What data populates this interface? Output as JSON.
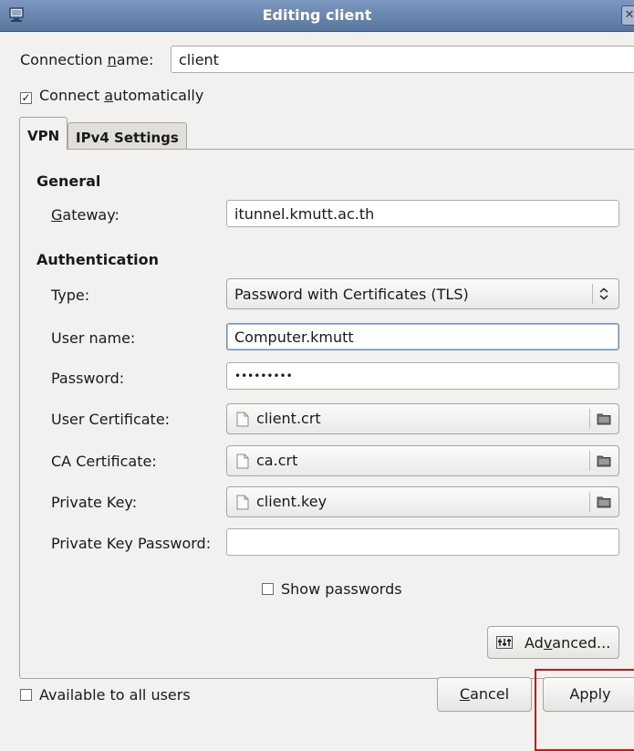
{
  "window": {
    "title": "Editing client",
    "close_glyph": "✕"
  },
  "connection": {
    "name_label_pre": "Connection ",
    "name_label_mnemonic": "n",
    "name_label_post": "ame:",
    "name_value": "client",
    "auto_pre": "Connect ",
    "auto_mnemonic": "a",
    "auto_post": "utomatically",
    "auto_checked": true
  },
  "tabs": [
    {
      "label": "VPN",
      "active": true
    },
    {
      "label": "IPv4 Settings",
      "active": false
    }
  ],
  "general": {
    "heading": "General",
    "gateway_mnemonic": "G",
    "gateway_post": "ateway:",
    "gateway_value": "itunnel.kmutt.ac.th"
  },
  "auth": {
    "heading": "Authentication",
    "type_label": "Type:",
    "type_value": "Password with Certificates (TLS)",
    "username_label": "User name:",
    "username_value": "Computer.kmutt",
    "password_label": "Password:",
    "password_value": "•••••••••",
    "user_cert_label": "User Certificate:",
    "user_cert_value": "client.crt",
    "ca_cert_label": "CA Certificate:",
    "ca_cert_value": "ca.crt",
    "private_key_label": "Private Key:",
    "private_key_value": "client.key",
    "pk_password_label": "Private Key Password:",
    "pk_password_value": "",
    "show_passwords_label": "Show passwords",
    "show_passwords_checked": false
  },
  "advanced": {
    "pre": "Ad",
    "mnemonic": "v",
    "post": "anced..."
  },
  "footer": {
    "available_label": "Available to all users",
    "available_checked": false,
    "cancel_mnemonic": "C",
    "cancel_post": "ancel",
    "apply_label": "Apply"
  },
  "icons": {
    "combo_arrows": "⌃⌄"
  }
}
